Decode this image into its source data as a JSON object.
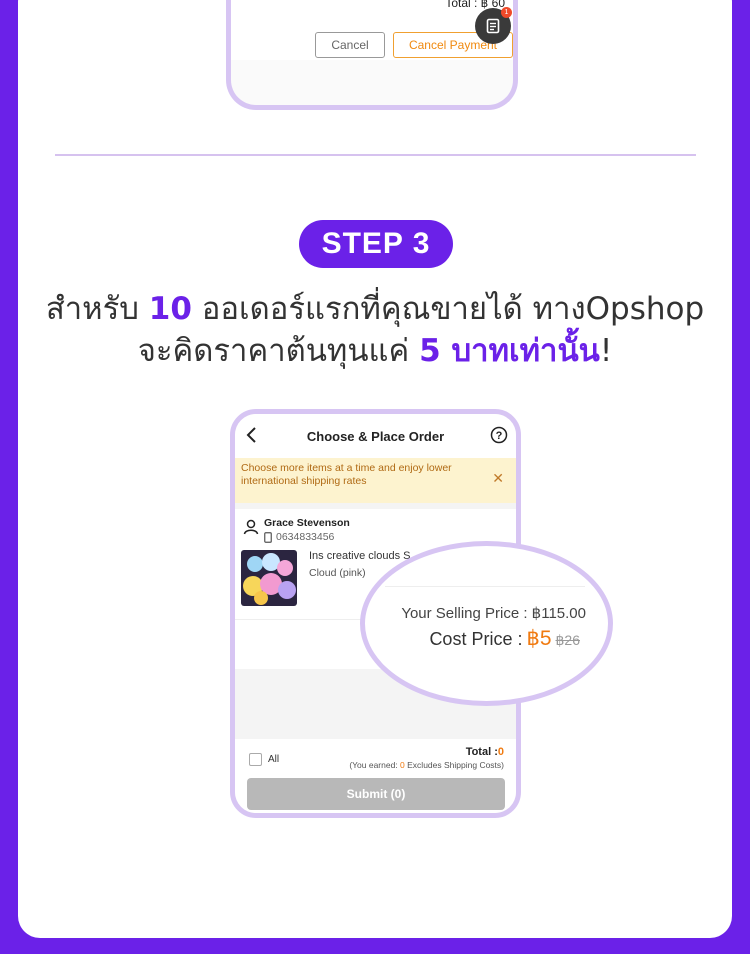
{
  "top_phone": {
    "total_text": "Total : ฿ 60",
    "cancel_label": "Cancel",
    "cancel_payment_label": "Cancel Payment",
    "badge": "1"
  },
  "step": {
    "label": "STEP 3",
    "line1_pre": "สำหรับ ",
    "line1_num": "10",
    "line1_post": " ออเดอร์แรกที่คุณขายได้ ทางOpshop",
    "line2_pre": "จะคิดราคาต้นทุนแค่ ",
    "line2_hl": "5 บาทเท่านั้น",
    "line2_post": "!"
  },
  "phone": {
    "title": "Choose & Place Order",
    "banner": "Choose more items at a time and enjoy lower international shipping rates",
    "user_name": "Grace Stevenson",
    "user_phone": "0634833456",
    "product_name": "Ins creative clouds S",
    "product_variant": "Cloud (pink)",
    "all_label": "All",
    "total_label": "Total :",
    "total_value": "0",
    "earned_pre": "(You earned: ",
    "earned_value": "0",
    "earned_post": " Excludes Shipping Costs)",
    "submit_label": "Submit (0)"
  },
  "zoom": {
    "selling_price": "Your Selling Price : ฿115.00",
    "cost_label": "Cost Price :",
    "cost_now": "฿5",
    "cost_old": "฿26"
  },
  "colors": {
    "brand_purple": "#6b21e8",
    "accent_orange": "#f07a10",
    "frame_lavender": "#d7c5f3"
  }
}
